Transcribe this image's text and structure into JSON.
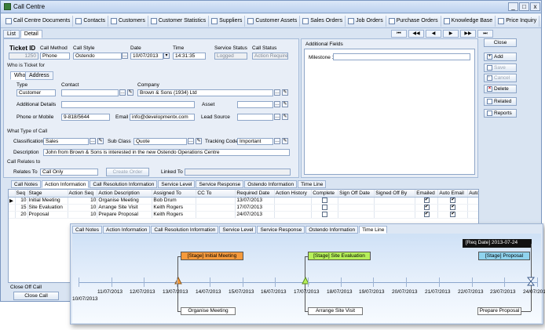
{
  "window": {
    "title": "Call Centre",
    "min": "_",
    "max": "□",
    "close": "x"
  },
  "toolbar": [
    "Call Centre Documents",
    "Contacts",
    "Customers",
    "Customer Statistics",
    "Suppliers",
    "Customer Assets",
    "Sales Orders",
    "Job Orders",
    "Purchase Orders",
    "Knowledge Base",
    "Price Inquiry"
  ],
  "tabs": {
    "list": "List",
    "detail": "Detail"
  },
  "nav": [
    "⏮",
    "◀◀",
    "◀",
    "▶",
    "▶▶",
    "⏭"
  ],
  "header": {
    "ticket_id_label": "Ticket ID",
    "ticket_id": "1250",
    "call_method_label": "Call Method",
    "call_method": "Phone",
    "call_style_label": "Call Style",
    "call_style": "Ostendo",
    "date_label": "Date",
    "date": "10/07/2013",
    "time_label": "Time",
    "time": "14:31:35",
    "service_status_label": "Service Status",
    "service_status": "Logged",
    "call_status_label": "Call Status",
    "call_status": "Action Required"
  },
  "who": {
    "section": "Who is Ticket for",
    "tab_who": "Who",
    "tab_address": "Address",
    "type_label": "Type",
    "type": "Customer",
    "contact_label": "Contact",
    "contact": "",
    "company_label": "Company",
    "company": "Brown & Sons (1934) Ltd",
    "additional_label": "Additional Details",
    "additional": "",
    "asset_label": "Asset",
    "asset": "",
    "phone_label": "Phone or Mobile",
    "phone": "9-818/5644",
    "email_label": "Email",
    "email": "info@developmentx.com",
    "lead_label": "Lead Source",
    "lead": ""
  },
  "what": {
    "section": "What Type of Call",
    "classification_label": "Classification",
    "classification": "Sales",
    "subclass_label": "Sub Class",
    "subclass": "Quote",
    "tracking_label": "Tracking Code",
    "tracking": "Important",
    "description_label": "Description",
    "description": "John from Brown & Sons is interested in the new Ostendo Operations Centre"
  },
  "relates": {
    "section": "Call Relates to",
    "relates_label": "Relates To",
    "relates": "Call Only",
    "create_order": "Create Order",
    "linked_label": "Linked To",
    "linked": ""
  },
  "additional_fields": {
    "title": "Additional Fields",
    "milestone_label": "Milestone 1:",
    "milestone": ""
  },
  "right_buttons": {
    "close": "Close",
    "add": "Add",
    "save": "Save",
    "cancel": "Cancel",
    "delete": "Delete",
    "related": "Related",
    "reports": "Reports"
  },
  "bottom_tabs": [
    "Call Notes",
    "Action Information",
    "Call Resolution Information",
    "Service Level",
    "Service Response",
    "Ostendo Information",
    "Time Line"
  ],
  "grid": {
    "columns": [
      "Seq",
      "Stage",
      "Action Seq",
      "Action Description",
      "Assigned To",
      "CC To",
      "Required Date",
      "Action History",
      "Complete",
      "Sign Off Date",
      "Signed Off By",
      "Emailed",
      "Auto Email",
      "Auto Ema"
    ],
    "rows": [
      {
        "seq": "10",
        "stage": "Initial Meeting",
        "aseq": "10",
        "desc": "Organise Meeting",
        "assigned": "Bob Drum",
        "cc": "",
        "date": "13/07/2013",
        "history": "",
        "complete": false,
        "signoff": "",
        "signedby": "",
        "emailed": true,
        "auto": true
      },
      {
        "seq": "15",
        "stage": "Site Evaluation",
        "aseq": "10",
        "desc": "Arrange Site Visit",
        "assigned": "Keith Rogers",
        "cc": "",
        "date": "17/07/2013",
        "history": "",
        "complete": false,
        "signoff": "",
        "signedby": "",
        "emailed": true,
        "auto": true
      },
      {
        "seq": "20",
        "stage": "Proposal",
        "aseq": "10",
        "desc": "Prepare Proposal",
        "assigned": "Keith Rogers",
        "cc": "",
        "date": "24/07/2013",
        "history": "",
        "complete": false,
        "signoff": "",
        "signedby": "",
        "emailed": true,
        "auto": true
      }
    ]
  },
  "bottom": {
    "close_off": "Close Off Call",
    "close_call": "Close Call"
  },
  "timeline": {
    "tabs": [
      "Call Notes",
      "Action Information",
      "Call Resolution Information",
      "Service Level",
      "Service Response",
      "Ostendo Information",
      "Time Line"
    ],
    "dates": [
      "10/07/2013",
      "11/07/2013",
      "12/07/2013",
      "13/07/2013",
      "14/07/2013",
      "15/07/2013",
      "16/07/2013",
      "17/07/2013",
      "18/07/2013",
      "19/07/2013",
      "20/07/2013",
      "21/07/2013",
      "22/07/2013",
      "23/07/2013",
      "24/07/2013"
    ],
    "stages": [
      {
        "label": "[Stage] Initial Meeting",
        "color": "#f59a3c"
      },
      {
        "label": "[Stage] Site Evaluation",
        "color": "#b6f05a"
      },
      {
        "label": "[Stage] Proposal",
        "color": "#8fd3ee"
      }
    ],
    "actions": [
      "Organise Meeting",
      "Arrange Site Visit",
      "Prepare Proposal"
    ],
    "req_date": "[Req Date] 2013-07-24"
  }
}
